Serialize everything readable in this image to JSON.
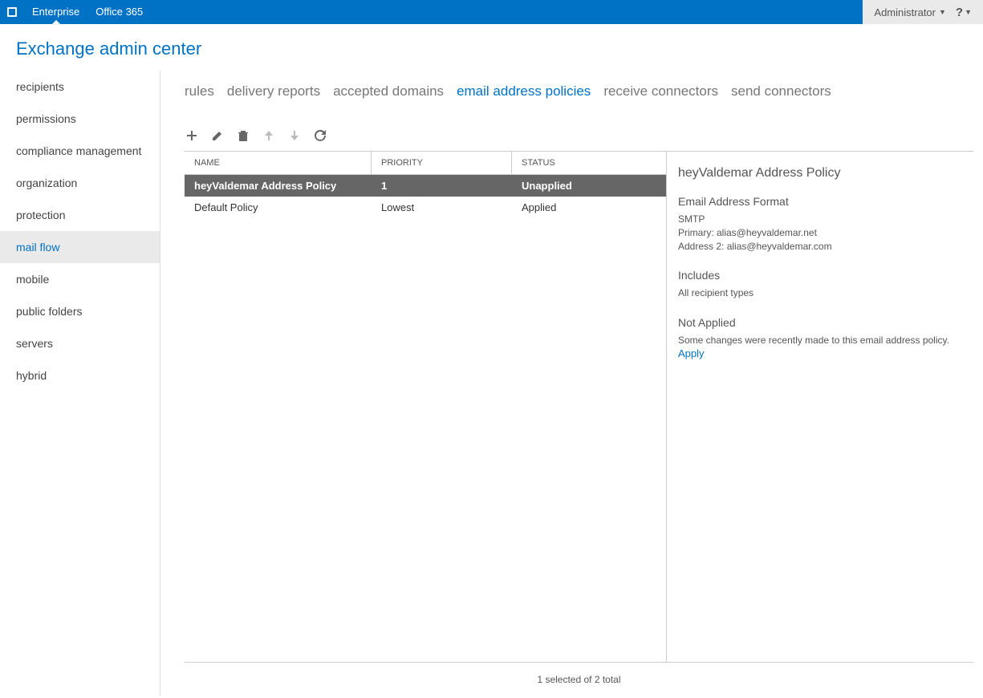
{
  "topbar": {
    "enterprise": "Enterprise",
    "office365": "Office 365",
    "admin": "Administrator",
    "help": "?"
  },
  "pageTitle": "Exchange admin center",
  "sidebar": {
    "items": [
      {
        "label": "recipients"
      },
      {
        "label": "permissions"
      },
      {
        "label": "compliance management"
      },
      {
        "label": "organization"
      },
      {
        "label": "protection"
      },
      {
        "label": "mail flow"
      },
      {
        "label": "mobile"
      },
      {
        "label": "public folders"
      },
      {
        "label": "servers"
      },
      {
        "label": "hybrid"
      }
    ],
    "selectedIndex": 5
  },
  "tabs": {
    "items": [
      {
        "label": "rules"
      },
      {
        "label": "delivery reports"
      },
      {
        "label": "accepted domains"
      },
      {
        "label": "email address policies"
      },
      {
        "label": "receive connectors"
      },
      {
        "label": "send connectors"
      }
    ],
    "activeIndex": 3
  },
  "grid": {
    "headers": {
      "name": "NAME",
      "priority": "PRIORITY",
      "status": "STATUS"
    },
    "rows": [
      {
        "name": "heyValdemar Address Policy",
        "priority": "1",
        "status": "Unapplied"
      },
      {
        "name": "Default Policy",
        "priority": "Lowest",
        "status": "Applied"
      }
    ],
    "selectedIndex": 0
  },
  "details": {
    "title": "heyValdemar Address Policy",
    "formatHead": "Email Address Format",
    "formatLines": [
      "SMTP",
      "Primary: alias@heyvaldemar.net",
      "Address 2: alias@heyvaldemar.com"
    ],
    "includesHead": "Includes",
    "includesText": "All recipient types",
    "notAppliedHead": "Not Applied",
    "notAppliedText": "Some changes were recently made to this email address policy.",
    "applyLabel": "Apply"
  },
  "footer": "1 selected of 2 total"
}
